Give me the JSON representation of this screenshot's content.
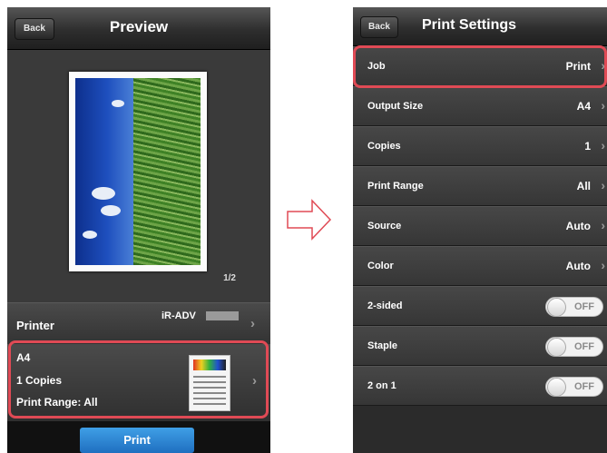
{
  "left_screen": {
    "back_label": "Back",
    "title": "Preview",
    "page_indicator": "1/2",
    "printer": {
      "label": "Printer",
      "name": "iR-ADV"
    },
    "settings_summary": {
      "size": "A4",
      "copies": "1 Copies",
      "range": "Print Range: All"
    },
    "print_button": "Print"
  },
  "right_screen": {
    "back_label": "Back",
    "title": "Print Settings",
    "rows": [
      {
        "label": "Job",
        "value": "Print"
      },
      {
        "label": "Output Size",
        "value": "A4"
      },
      {
        "label": "Copies",
        "value": "1"
      },
      {
        "label": "Print Range",
        "value": "All"
      },
      {
        "label": "Source",
        "value": "Auto"
      },
      {
        "label": "Color",
        "value": "Auto"
      }
    ],
    "toggles": [
      {
        "label": "2-sided",
        "state": "OFF"
      },
      {
        "label": "Staple",
        "state": "OFF"
      },
      {
        "label": "2 on 1",
        "state": "OFF"
      }
    ]
  },
  "colors": {
    "highlight": "#e04a55",
    "print_button": "#2f8ad8"
  }
}
